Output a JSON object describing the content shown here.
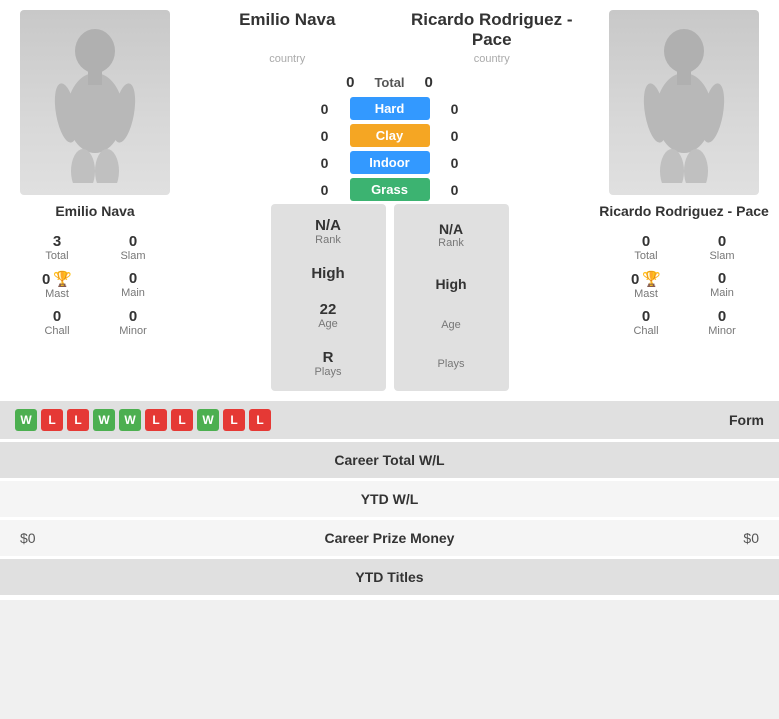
{
  "players": {
    "left": {
      "name": "Emilio Nava",
      "name_label": "Emilio Nava",
      "country": "country",
      "stats": {
        "total": "3",
        "total_label": "Total",
        "slam": "0",
        "slam_label": "Slam",
        "mast": "0",
        "mast_label": "Mast",
        "main": "0",
        "main_label": "Main",
        "chall": "0",
        "chall_label": "Chall",
        "minor": "0",
        "minor_label": "Minor"
      }
    },
    "right": {
      "name": "Ricardo Rodriguez - Pace",
      "name_label": "Ricardo Rodriguez - Pace",
      "country": "country",
      "stats": {
        "total": "0",
        "total_label": "Total",
        "slam": "0",
        "slam_label": "Slam",
        "mast": "0",
        "mast_label": "Mast",
        "main": "0",
        "main_label": "Main",
        "chall": "0",
        "chall_label": "Chall",
        "minor": "0",
        "minor_label": "Minor"
      }
    }
  },
  "scores": {
    "total_label": "Total",
    "total_left": "0",
    "total_right": "0",
    "surfaces": [
      {
        "label": "Hard",
        "type": "hard",
        "left": "0",
        "right": "0"
      },
      {
        "label": "Clay",
        "type": "clay",
        "left": "0",
        "right": "0"
      },
      {
        "label": "Indoor",
        "type": "indoor",
        "left": "0",
        "right": "0"
      },
      {
        "label": "Grass",
        "type": "grass",
        "left": "0",
        "right": "0"
      }
    ]
  },
  "center_stats": {
    "rank": {
      "value": "N/A",
      "label": "Rank"
    },
    "high": {
      "value": "High",
      "label": ""
    },
    "age": {
      "value": "22",
      "label": "Age"
    },
    "plays": {
      "value": "R",
      "label": "Plays"
    }
  },
  "right_stats": {
    "rank": {
      "value": "N/A",
      "label": "Rank"
    },
    "high": {
      "value": "High",
      "label": ""
    },
    "age": {
      "value": "",
      "label": "Age"
    },
    "plays": {
      "value": "",
      "label": "Plays"
    }
  },
  "form": {
    "label": "Form",
    "badges": [
      "W",
      "L",
      "L",
      "W",
      "W",
      "L",
      "L",
      "W",
      "L",
      "L"
    ]
  },
  "career_wl": {
    "label": "Career Total W/L"
  },
  "ytd_wl": {
    "label": "YTD W/L"
  },
  "prize_money": {
    "label": "Career Prize Money",
    "left_value": "$0",
    "right_value": "$0"
  },
  "ytd_titles": {
    "label": "YTD Titles"
  }
}
